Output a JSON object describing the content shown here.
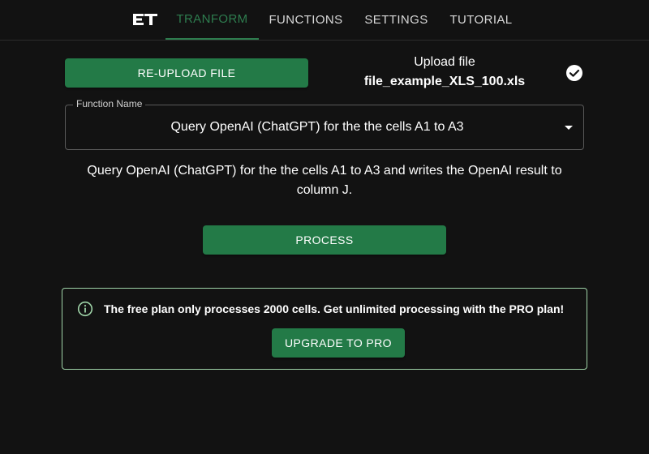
{
  "nav": {
    "logo_text": "ET",
    "tabs": [
      {
        "label": "TRANFORM",
        "active": true
      },
      {
        "label": "FUNCTIONS",
        "active": false
      },
      {
        "label": "SETTINGS",
        "active": false
      },
      {
        "label": "TUTORIAL",
        "active": false
      }
    ]
  },
  "upload": {
    "reupload_label": "RE-UPLOAD FILE",
    "status_label": "Upload file",
    "filename": "file_example_XLS_100.xls",
    "status_icon": "check-circle-icon"
  },
  "function_select": {
    "legend": "Function Name",
    "value": "Query OpenAI (ChatGPT) for the the cells A1 to A3"
  },
  "description": "Query OpenAI (ChatGPT) for the the cells A1 to A3 and writes the OpenAI result to column J.",
  "process_label": "PROCESS",
  "alert": {
    "icon": "info-icon",
    "message": "The free plan only processes 2000 cells. Get unlimited processing with the PRO plan!",
    "upgrade_label": "UPGRADE TO PRO"
  },
  "colors": {
    "background": "#121212",
    "accent": "#237a47",
    "active_tab": "#2e7d4f",
    "alert_border": "#9fd4a8",
    "alert_icon": "#9fd4a8"
  }
}
